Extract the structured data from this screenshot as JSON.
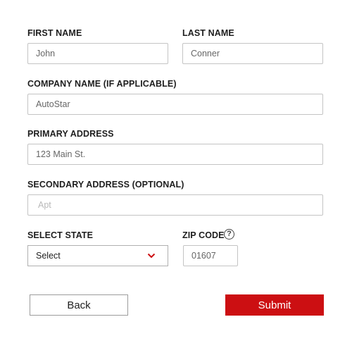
{
  "form": {
    "first_name": {
      "label": "FIRST NAME",
      "value": "John"
    },
    "last_name": {
      "label": "LAST NAME",
      "value": "Conner"
    },
    "company": {
      "label": "COMPANY NAME (IF APPLICABLE)",
      "value": "AutoStar"
    },
    "primary_address": {
      "label": "PRIMARY ADDRESS",
      "value": "123 Main St."
    },
    "secondary_address": {
      "label": "SECONDARY ADDRESS (OPTIONAL)",
      "value": "",
      "placeholder": "Apt"
    },
    "state": {
      "label": "SELECT STATE",
      "value": "Select"
    },
    "zip": {
      "label": "ZIP CODE",
      "value": "01607",
      "help_icon": "question-circle-icon"
    }
  },
  "actions": {
    "back_label": "Back",
    "submit_label": "Submit"
  },
  "colors": {
    "accent": "#cc0f12",
    "label_text": "#1e1e1e",
    "border": "#c4c4c4"
  },
  "icons": {
    "state_dropdown": "chevron-down-icon"
  }
}
